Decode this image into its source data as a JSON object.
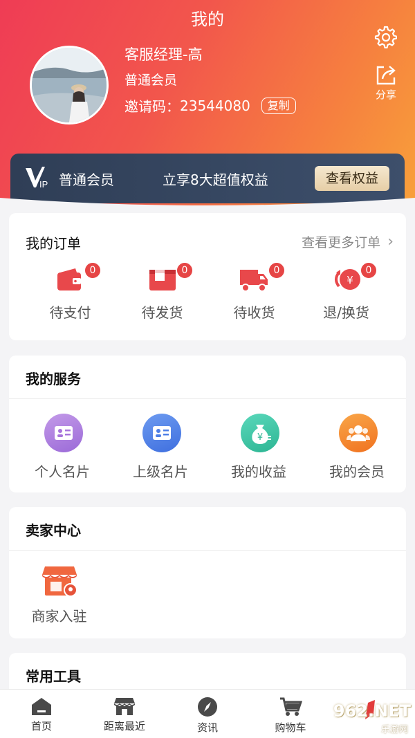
{
  "header": {
    "title": "我的",
    "user_name": "客服经理-高",
    "member_level": "普通会员",
    "invite_label": "邀请码：",
    "invite_code": "23544080",
    "copy_label": "复制",
    "share_label": "分享"
  },
  "vip": {
    "logo_text": "VIP",
    "level": "普通会员",
    "benefit_text": "立享8大超值权益",
    "button_label": "查看权益"
  },
  "orders": {
    "title": "我的订单",
    "more_label": "查看更多订单",
    "items": [
      {
        "label": "待支付",
        "count": "0",
        "icon": "wallet-icon"
      },
      {
        "label": "待发货",
        "count": "0",
        "icon": "package-box-icon"
      },
      {
        "label": "待收货",
        "count": "0",
        "icon": "delivery-truck-icon"
      },
      {
        "label": "退/换货",
        "count": "0",
        "icon": "refund-yuan-icon"
      }
    ]
  },
  "services": {
    "title": "我的服务",
    "items": [
      {
        "label": "个人名片",
        "icon": "business-card-icon",
        "color": "#b07fe0"
      },
      {
        "label": "上级名片",
        "icon": "business-card-icon",
        "color": "#4e7fe6"
      },
      {
        "label": "我的收益",
        "icon": "money-bag-icon",
        "color": "#3fc7a8"
      },
      {
        "label": "我的会员",
        "icon": "members-group-icon",
        "color": "#f5892e"
      }
    ]
  },
  "seller": {
    "title": "卖家中心",
    "items": [
      {
        "label": "商家入驻",
        "icon": "storefront-location-icon"
      }
    ]
  },
  "tools": {
    "title": "常用工具"
  },
  "tabbar": {
    "items": [
      {
        "label": "首页",
        "icon": "home-icon"
      },
      {
        "label": "距离最近",
        "icon": "store-icon"
      },
      {
        "label": "资讯",
        "icon": "compass-icon"
      },
      {
        "label": "购物车",
        "icon": "cart-icon"
      }
    ]
  },
  "watermark": {
    "text": "962.NET",
    "sub": "乐游网"
  },
  "colors": {
    "accent_red": "#e64545",
    "header_gradient_start": "#ef3c55",
    "header_gradient_end": "#f8a13a",
    "vip_bar": "#2f3e56"
  }
}
